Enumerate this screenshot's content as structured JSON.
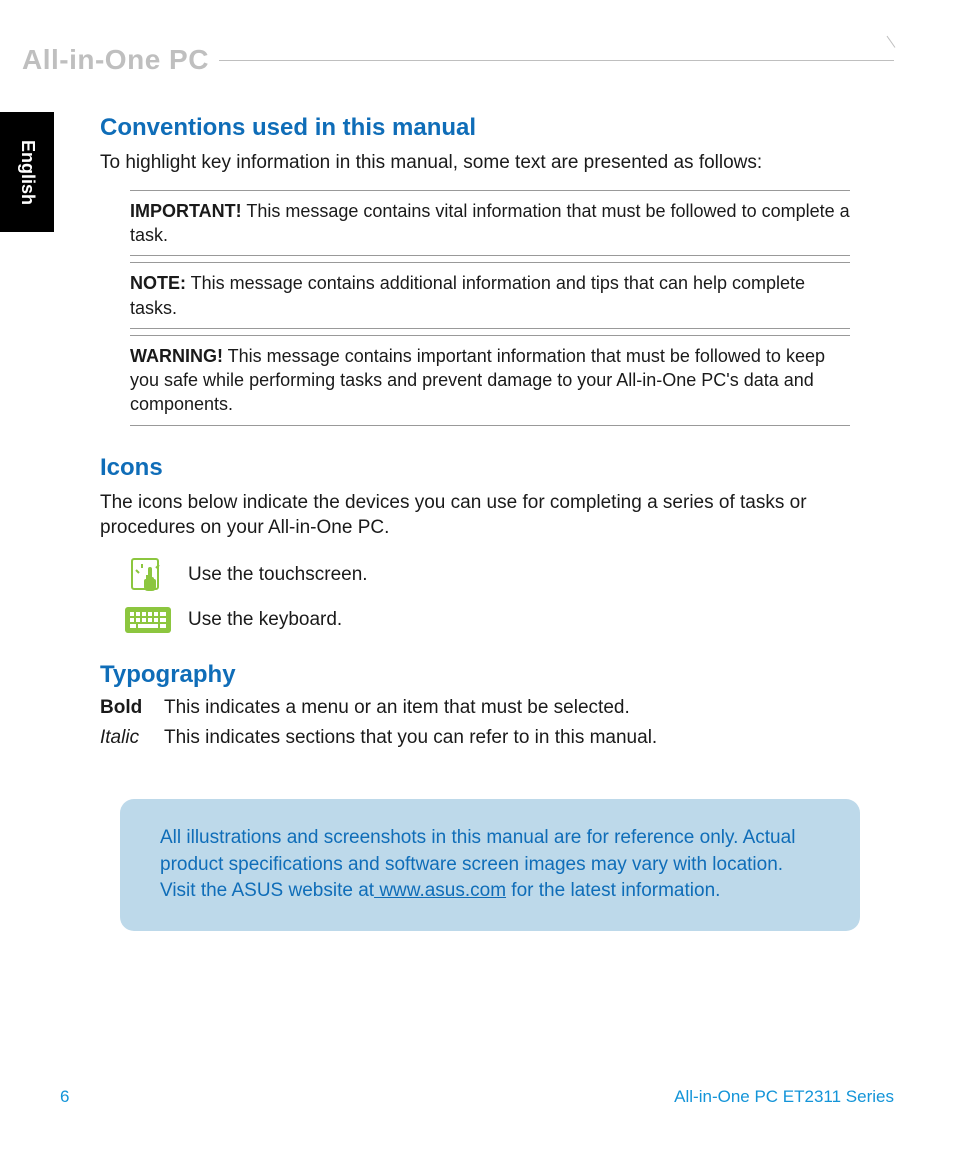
{
  "header": {
    "product_line": "All-in-One PC"
  },
  "language_tab": "English",
  "sections": {
    "conventions": {
      "heading": "Conventions used in this manual",
      "intro": "To highlight key information in this manual, some text are presented as follows:",
      "messages": [
        {
          "label": "IMPORTANT!",
          "text": "  This message contains vital information that must be followed to complete a task."
        },
        {
          "label": "NOTE:",
          "text": "    This message contains additional information and tips that can help complete tasks."
        },
        {
          "label": "WARNING!",
          "text": "  This message contains important information that must be followed to keep you safe while performing tasks and prevent damage to your All-in-One PC's data and components."
        }
      ]
    },
    "icons": {
      "heading": "Icons",
      "intro": "The icons below indicate the devices you can use for completing a series of tasks or procedures on your All-in-One PC.",
      "items": [
        {
          "icon": "touchscreen",
          "text": "Use the touchscreen."
        },
        {
          "icon": "keyboard",
          "text": "Use the keyboard."
        }
      ]
    },
    "typography": {
      "heading": "Typography",
      "items": [
        {
          "label": "Bold",
          "style": "bold",
          "text": "This indicates a menu or an item that must be selected."
        },
        {
          "label": "Italic",
          "style": "italic",
          "text": "This indicates sections that you can refer to in this manual."
        }
      ]
    },
    "callout": {
      "text_before": "All illustrations and screenshots in this manual are for reference only. Actual product specifications and software screen images may vary with location. Visit the ASUS website at",
      "link": " www.asus.com",
      "text_after": " for the latest information."
    }
  },
  "footer": {
    "page_number": "6",
    "series": "All-in-One PC ET2311 Series"
  }
}
